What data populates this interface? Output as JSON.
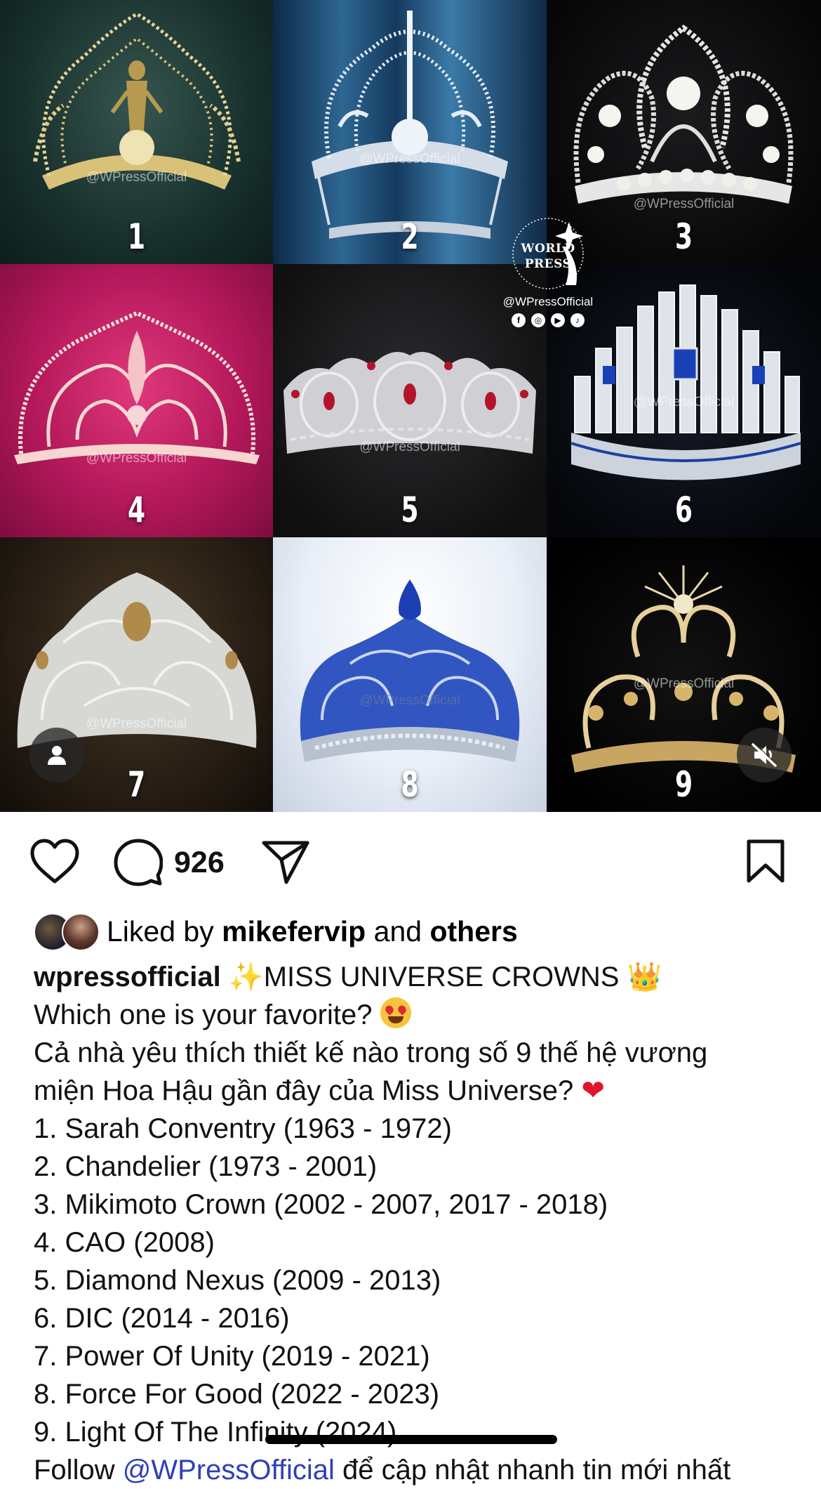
{
  "post": {
    "tiles": [
      {
        "number": "1",
        "watermark": "@WPressOfficial"
      },
      {
        "number": "2",
        "watermark": "@WPressOfficial"
      },
      {
        "number": "3",
        "watermark": "@WPressOfficial"
      },
      {
        "number": "4",
        "watermark": "@WPressOfficial"
      },
      {
        "number": "5",
        "watermark": "@WPressOfficial"
      },
      {
        "number": "6",
        "watermark": "@WPressOfficial"
      },
      {
        "number": "7",
        "watermark": "@WPressOfficial"
      },
      {
        "number": "8",
        "watermark": "@WPressOfficial"
      },
      {
        "number": "9",
        "watermark": "@WPressOfficial"
      }
    ],
    "logo": {
      "line1": "WORLD",
      "line2": "PRESS",
      "handle": "@WPressOfficial",
      "socials": [
        "f",
        "◎",
        "▶",
        "♪"
      ]
    }
  },
  "actions": {
    "comment_count": "926",
    "icons": [
      "heart-icon",
      "comment-icon",
      "share-icon",
      "bookmark-icon"
    ]
  },
  "liked_by": {
    "prefix": "Liked by",
    "user": "mikefervip",
    "joiner": "and",
    "others": "others"
  },
  "caption": {
    "username": "wpressofficial",
    "sparkle": "✨",
    "title": "MISS UNIVERSE CROWNS",
    "crown": "👑",
    "question_en": "Which one is your favorite?",
    "question_vi_1": "Cả nhà yêu thích thiết kế nào trong số 9 thế hệ vương",
    "question_vi_2": "miện Hoa Hậu gần đây của Miss Universe?",
    "heart": "❤",
    "list": [
      "1. Sarah Conventry (1963 - 1972)",
      "2. Chandelier (1973 - 2001)",
      "3. Mikimoto Crown (2002 - 2007, 2017 - 2018)",
      "4. CAO (2008)",
      "5. Diamond Nexus (2009 - 2013)",
      "6. DIC (2014 - 2016)",
      "7. Power Of Unity (2019 - 2021)",
      "8. Force For Good (2022 - 2023)",
      "9. Light Of The Infinity (2024)"
    ],
    "follow_prefix": "Follow",
    "follow_mention": "@WPressOfficial",
    "follow_suffix": "để cập nhật nhanh tin mới nhất"
  }
}
